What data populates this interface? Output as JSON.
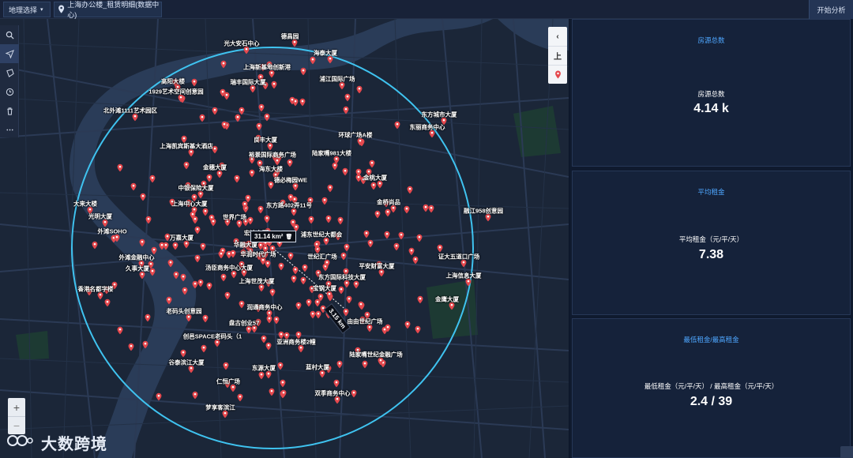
{
  "topbar": {
    "region_select": "地理选择",
    "breadcrumb": "上海办公楼_租赁明细(数据中心)",
    "start_button": "开始分析"
  },
  "map": {
    "radius_label": "31.14 km²",
    "distance_label": "3.15 km",
    "side_label": "上",
    "labels": [
      {
        "text": "德昌园"
      },
      {
        "text": "光大安石中心"
      },
      {
        "text": "海泰大厦"
      },
      {
        "text": "上海新基地创新港"
      },
      {
        "text": "瑞丰国际大厦"
      },
      {
        "text": "高阳大楼"
      },
      {
        "text": "浦江国际广场"
      },
      {
        "text": "1929艺术空间创意园"
      },
      {
        "text": "北外滩1111艺术园区"
      },
      {
        "text": "东方城市大厦"
      },
      {
        "text": "东丽商务中心"
      },
      {
        "text": "环球广场A楼"
      },
      {
        "text": "良丰大厦"
      },
      {
        "text": "上海凯宾斯基大酒店"
      },
      {
        "text": "裕景国际商务广场"
      },
      {
        "text": "陆家嘴981大楼"
      },
      {
        "text": "金穗大厦"
      },
      {
        "text": "海东大楼"
      },
      {
        "text": "德必梅园WE"
      },
      {
        "text": "金桃大厦"
      },
      {
        "text": "中银保险大厦"
      },
      {
        "text": "金桥尚品"
      },
      {
        "text": "大来大楼"
      },
      {
        "text": "上海中心大厦"
      },
      {
        "text": "东方路402弄11号"
      },
      {
        "text": "融江958创意园"
      },
      {
        "text": "光明大厦"
      },
      {
        "text": "世界广场"
      },
      {
        "text": "外滩SOHO"
      },
      {
        "text": "万嘉大厦"
      },
      {
        "text": "宏达大厦"
      },
      {
        "text": "浦东世纪大都会"
      },
      {
        "text": "华融大厦"
      },
      {
        "text": "华润时代广场"
      },
      {
        "text": "世纪汇广场"
      },
      {
        "text": "证大五道口广场"
      },
      {
        "text": "外滩金融中心"
      },
      {
        "text": "平安财富大厦"
      },
      {
        "text": "久事大厦"
      },
      {
        "text": "汤臣商务中心大厦"
      },
      {
        "text": "东方国际科技大厦"
      },
      {
        "text": "上海信息大厦"
      },
      {
        "text": "上海世茂大厦"
      },
      {
        "text": "香港名都字楼"
      },
      {
        "text": "宝钢大厦"
      },
      {
        "text": "金鹰大厦"
      },
      {
        "text": "润通商务中心"
      },
      {
        "text": "老码头创意园"
      },
      {
        "text": "盘古创业57"
      },
      {
        "text": "由由世纪广场"
      },
      {
        "text": "创邑SPACE老码头（1"
      },
      {
        "text": "亚洲商务楼2幢"
      },
      {
        "text": "陆家嘴世纪金融广场"
      },
      {
        "text": "谷泰滨江大厦"
      },
      {
        "text": "东源大厦"
      },
      {
        "text": "蓝村大厦"
      },
      {
        "text": "仁恒广场"
      },
      {
        "text": "双季商务中心"
      },
      {
        "text": "梦享客滨江"
      }
    ]
  },
  "panel": {
    "card1": {
      "title": "房源总数",
      "label": "房源总数",
      "value": "4.14 k"
    },
    "card2": {
      "title": "平均租金",
      "label": "平均租金（元/平/天）",
      "value": "7.38"
    },
    "card3": {
      "title": "最低租金/最高租金",
      "label": "最低租金（元/平/天） / 最高租金（元/平/天）",
      "value": "2.4 / 39"
    }
  },
  "watermark": {
    "text": "大数跨境"
  },
  "icons": {
    "search": "search-icon",
    "select": "select-arrow-icon",
    "draw": "draw-polygon-icon",
    "clock": "clock-icon",
    "trash": "trash-icon",
    "more": "more-icon",
    "pin": "map-pin-icon",
    "chevron": "chevron-left-icon",
    "zoom_in": "plus-icon",
    "zoom_out": "minus-icon"
  },
  "colors": {
    "pin": "#e5484d",
    "circle": "#3fc3f0",
    "accent": "#4ea7ff",
    "water": "#2a3c58"
  }
}
